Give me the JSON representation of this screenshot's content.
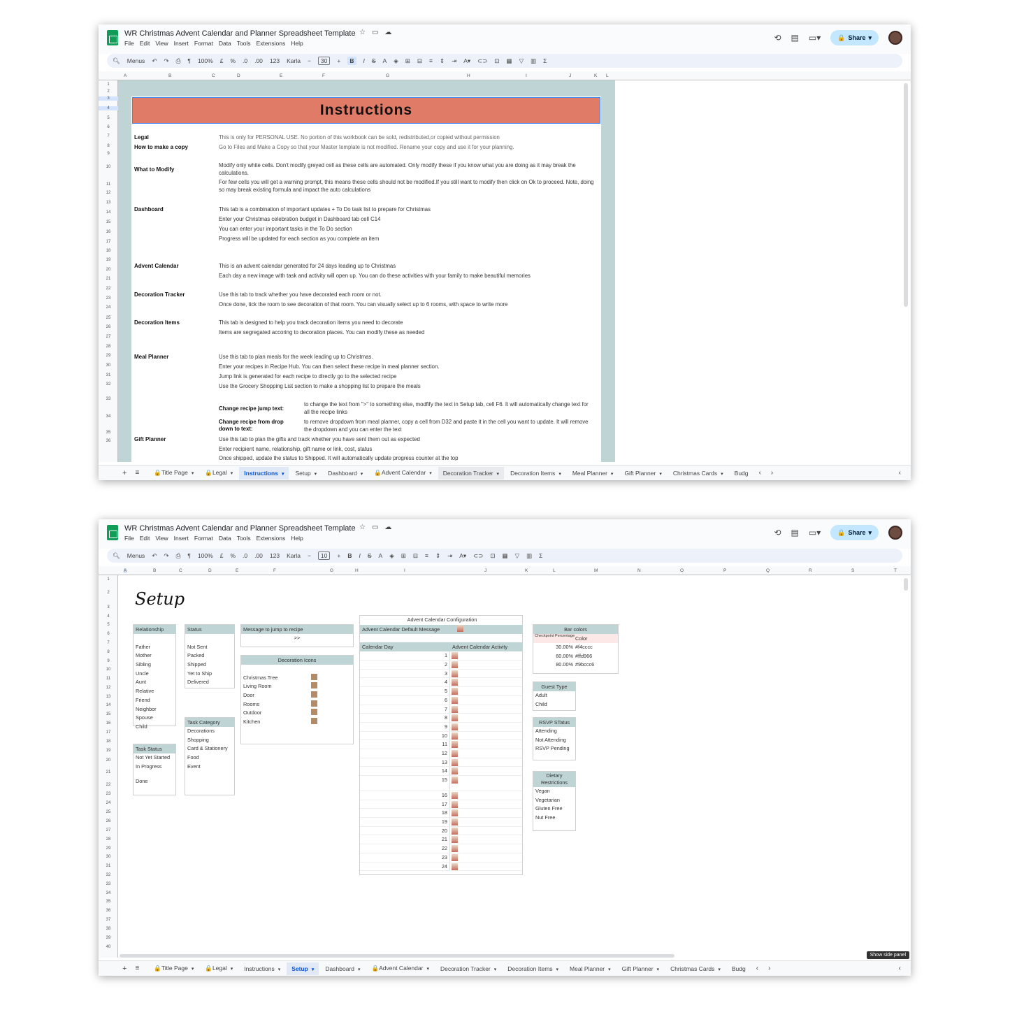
{
  "app": {
    "doc_title": "WR Christmas Advent Calendar and Planner Spreadsheet Template",
    "menus": [
      "File",
      "Edit",
      "View",
      "Insert",
      "Format",
      "Data",
      "Tools",
      "Extensions",
      "Help"
    ],
    "share_label": "Share",
    "toolbar": {
      "search": "Menus",
      "zoom": "100%",
      "currency": "£",
      "percent": "%",
      "dec_less": ".0",
      "dec_more": ".00",
      "num_fmt": "123",
      "font": "Karla",
      "bold": "B",
      "italic": "I",
      "strike": "S",
      "fn": "Σ"
    }
  },
  "tabs": [
    "Title Page",
    "Legal",
    "Instructions",
    "Setup",
    "Dashboard",
    "Advent Calendar",
    "Decoration Tracker",
    "Decoration Items",
    "Meal Planner",
    "Gift Planner",
    "Christmas Cards",
    "Budg"
  ],
  "window1": {
    "font_size": "30",
    "columns": [
      "A",
      "B",
      "C",
      "D",
      "E",
      "F",
      "G",
      "H",
      "I",
      "J",
      "K",
      "L"
    ],
    "rows": [
      "1",
      "2",
      "3",
      "4",
      "5",
      "6",
      "7",
      "8",
      "9",
      "10",
      "11",
      "12",
      "13",
      "14",
      "15",
      "16",
      "17",
      "18",
      "19",
      "20",
      "21",
      "22",
      "23",
      "24",
      "25",
      "26",
      "27",
      "28",
      "29",
      "30",
      "31",
      "32",
      "33",
      "34",
      "35",
      "36"
    ],
    "banner": "Instructions",
    "sections": [
      {
        "label": "Legal",
        "text": "This is only for PERSONAL USE. No portion of this workbook can be sold, redistributed,or copied without permission"
      },
      {
        "label": "How to make a copy",
        "text": "Go to Files and Make a Copy so that your Master template is not modified. Rename your copy and use it for your planning."
      },
      {
        "label": "What to Modify",
        "text": "Modify only white cells. Don't modify greyed cell as these cells are automated. Only modify these if you know what you are doing as it may break the calculations."
      },
      {
        "label": "",
        "text": "For few cells you will get a warning prompt, this means these cells should not be modified.If you still want to modify then click on Ok to proceed. Note, doing so may break existing formula and impact the auto calculations"
      },
      {
        "label": "Dashboard",
        "text": "This tab is a combination of important updates + To Do task list to prepare for Christmas"
      },
      {
        "label": "",
        "text": "Enter your Christmas celebration budget in Dashboard tab cell C14"
      },
      {
        "label": "",
        "text": "You can enter your important tasks in the To Do section"
      },
      {
        "label": "",
        "text": "Progress will be updated for each section as you complete an item"
      },
      {
        "label": "Advent Calendar",
        "text": "This is an advent calendar generated for 24 days leading up to Christmas"
      },
      {
        "label": "",
        "text": "Each day a new image with task and activity will open up. You can do these activities with your family to make beautiful memories"
      },
      {
        "label": "Decoration Tracker",
        "text": "Use this tab to track whether you have decorated each room or not."
      },
      {
        "label": "",
        "text": "Once done, tick the room to see decoration of that room. You can visually select up to 6 rooms, with space to write more"
      },
      {
        "label": "Decoration Items",
        "text": "This tab is designed to help you track decoration items you need to decorate"
      },
      {
        "label": "",
        "text": "Items are segregated accoring to decoration places. You can modify these as needed"
      },
      {
        "label": "Meal Planner",
        "text": "Use this tab to plan meals for the week leading up to Christmas."
      },
      {
        "label": "",
        "text": "Enter your recipes in Recipe Hub. You can then select these recipe in meal planner section."
      },
      {
        "label": "",
        "text": "Jump link is generated for each recipe to directly go to the selected recipe"
      },
      {
        "label": "",
        "text": "Use the Grocery Shopping List section to make a shopping list to prepare the meals"
      },
      {
        "label": "Gift Planner",
        "text": "Use this tab to plan the gifts and track whether you have sent them out as expected"
      },
      {
        "label": "",
        "text": "Enter recipient name, relationship, gift name or link, cost, status"
      },
      {
        "label": "",
        "text": "Once shipped, update the status to Shipped. It will automatically update progress counter at the top"
      }
    ],
    "subs": [
      {
        "label": "Change recipe jump text:",
        "text": "to change the text from \">\" to something else, modfify the text in Setup tab, cell F6. It will automatically change text for all the recipe links"
      },
      {
        "label": "Change recipe from drop down to text:",
        "text": "to remove dropdown from meal planner, copy a cell from D32 and paste it in the cell you want to update. It will remove the dropdown and you can enter the text"
      }
    ]
  },
  "window2": {
    "font_size": "10",
    "columns": [
      "A",
      "B",
      "C",
      "D",
      "E",
      "F",
      "G",
      "H",
      "I",
      "J",
      "K",
      "L",
      "M",
      "N",
      "O",
      "P",
      "Q",
      "R",
      "S",
      "T"
    ],
    "rows": [
      "1",
      "2",
      "3",
      "4",
      "5",
      "6",
      "7",
      "8",
      "9",
      "10",
      "11",
      "12",
      "13",
      "14",
      "15",
      "16",
      "17",
      "18",
      "19",
      "20",
      "21",
      "22",
      "23",
      "24",
      "25",
      "26",
      "27",
      "28",
      "29",
      "30",
      "31",
      "32",
      "33",
      "34",
      "35",
      "36",
      "37",
      "38",
      "39",
      "40"
    ],
    "title": "Setup",
    "relationship": {
      "header": "Relationship",
      "items": [
        "Father",
        "Mother",
        "Sibling",
        "Uncle",
        "Aunt",
        "Relative",
        "Friend",
        "Neighbor",
        "Spouse",
        "Child"
      ]
    },
    "status": {
      "header": "Status",
      "items": [
        "Not Sent",
        "Packed",
        "Shipped",
        "Yet to Ship",
        "Delivered"
      ]
    },
    "message": {
      "header": "Message to jump to recipe",
      "value": ">>"
    },
    "decoration_icons": {
      "header": "Decoration Icons",
      "items": [
        "Christmas Tree",
        "Living Room",
        "Door",
        "Rooms",
        "Outdoor",
        "Kitchen"
      ]
    },
    "task_category": {
      "header": "Task Category",
      "items": [
        "Decorations",
        "Shopping",
        "Card & Stationery",
        "Food",
        "Event"
      ]
    },
    "task_status": {
      "header": "Task Status",
      "items": [
        "Not Yet Started",
        "In Progress",
        "Done"
      ]
    },
    "advent": {
      "title": "Advent Calendar Configuration",
      "default_message": "Advent Calendar Default Message",
      "day_header": "Calendar Day",
      "activity_header": "Advent Calendar Activity",
      "days": [
        "1",
        "2",
        "3",
        "4",
        "5",
        "6",
        "7",
        "8",
        "9",
        "10",
        "11",
        "12",
        "13",
        "14",
        "15",
        "16",
        "17",
        "18",
        "19",
        "20",
        "21",
        "22",
        "23",
        "24"
      ]
    },
    "bar_colors": {
      "header": "Bar colors",
      "col1": "Checkpoint Percentage",
      "col2": "Color",
      "rows": [
        {
          "pct": "30.00%",
          "color": "#f4cccc"
        },
        {
          "pct": "60.00%",
          "color": "#ffd966"
        },
        {
          "pct": "80.00%",
          "color": "#9bccc6"
        }
      ]
    },
    "guest_type": {
      "header": "Guest Type",
      "items": [
        "Adult",
        "Child"
      ]
    },
    "rsvp": {
      "header": "RSVP STatus",
      "items": [
        "Attending",
        "Not Attending",
        "RSVP Pending"
      ]
    },
    "dietary": {
      "header": "Dietary Restrictions",
      "items": [
        "Vegan",
        "Vegetarian",
        "Gluten Free",
        "Nut Free"
      ]
    },
    "side_panel": "Show side panel"
  }
}
